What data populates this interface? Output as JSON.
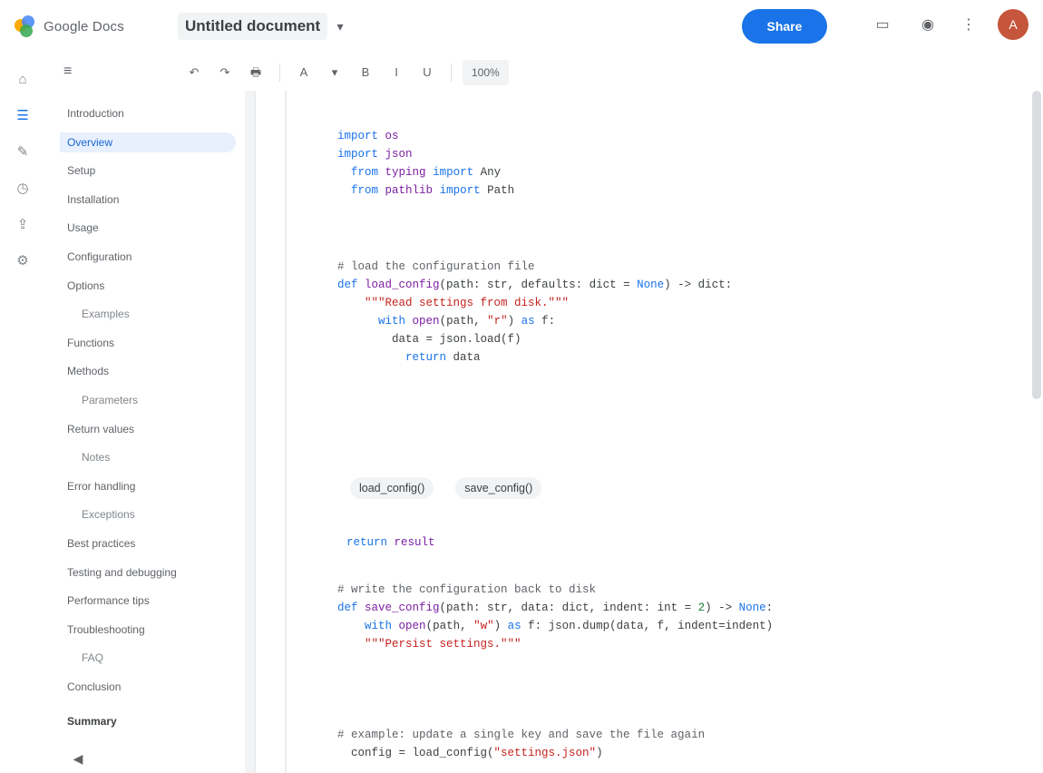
{
  "app": {
    "logo_text": "Google Docs",
    "doc_title": "Untitled document",
    "share_label": "Share",
    "avatar_initial": "A"
  },
  "toolbar": {
    "buttons": [
      "↶",
      "↷",
      "🖶",
      "A",
      "▾",
      "B",
      "I",
      "U"
    ],
    "zoom": "100%"
  },
  "outline": {
    "heading": "≡",
    "items": [
      {
        "label": "Introduction",
        "level": 0
      },
      {
        "label": "Overview",
        "level": 1
      },
      {
        "label": "Setup",
        "level": 0
      },
      {
        "label": "Installation",
        "level": 0
      },
      {
        "label": "Usage",
        "level": 0
      },
      {
        "label": "Configuration",
        "level": 0
      },
      {
        "label": "Options",
        "level": 0
      },
      {
        "label": "Examples",
        "level": 1
      },
      {
        "label": "Functions",
        "level": 0
      },
      {
        "label": "Methods",
        "level": 0
      },
      {
        "label": "Parameters",
        "level": 1
      },
      {
        "label": "Return values",
        "level": 0
      },
      {
        "label": "Notes",
        "level": 1
      },
      {
        "label": "Error handling",
        "level": 0
      },
      {
        "label": "Exceptions",
        "level": 1
      },
      {
        "label": "Best practices",
        "level": 0
      },
      {
        "label": "Testing and debugging",
        "level": 0
      },
      {
        "label": "Performance tips",
        "level": 0
      },
      {
        "label": "Troubleshooting",
        "level": 0
      },
      {
        "label": "FAQ",
        "level": 1
      },
      {
        "label": "Conclusion",
        "level": 0
      }
    ],
    "footer": "Summary"
  },
  "colors": {
    "accent": "#1a73e8",
    "keyword": "#1a73e8",
    "string": "#c5221f"
  }
}
